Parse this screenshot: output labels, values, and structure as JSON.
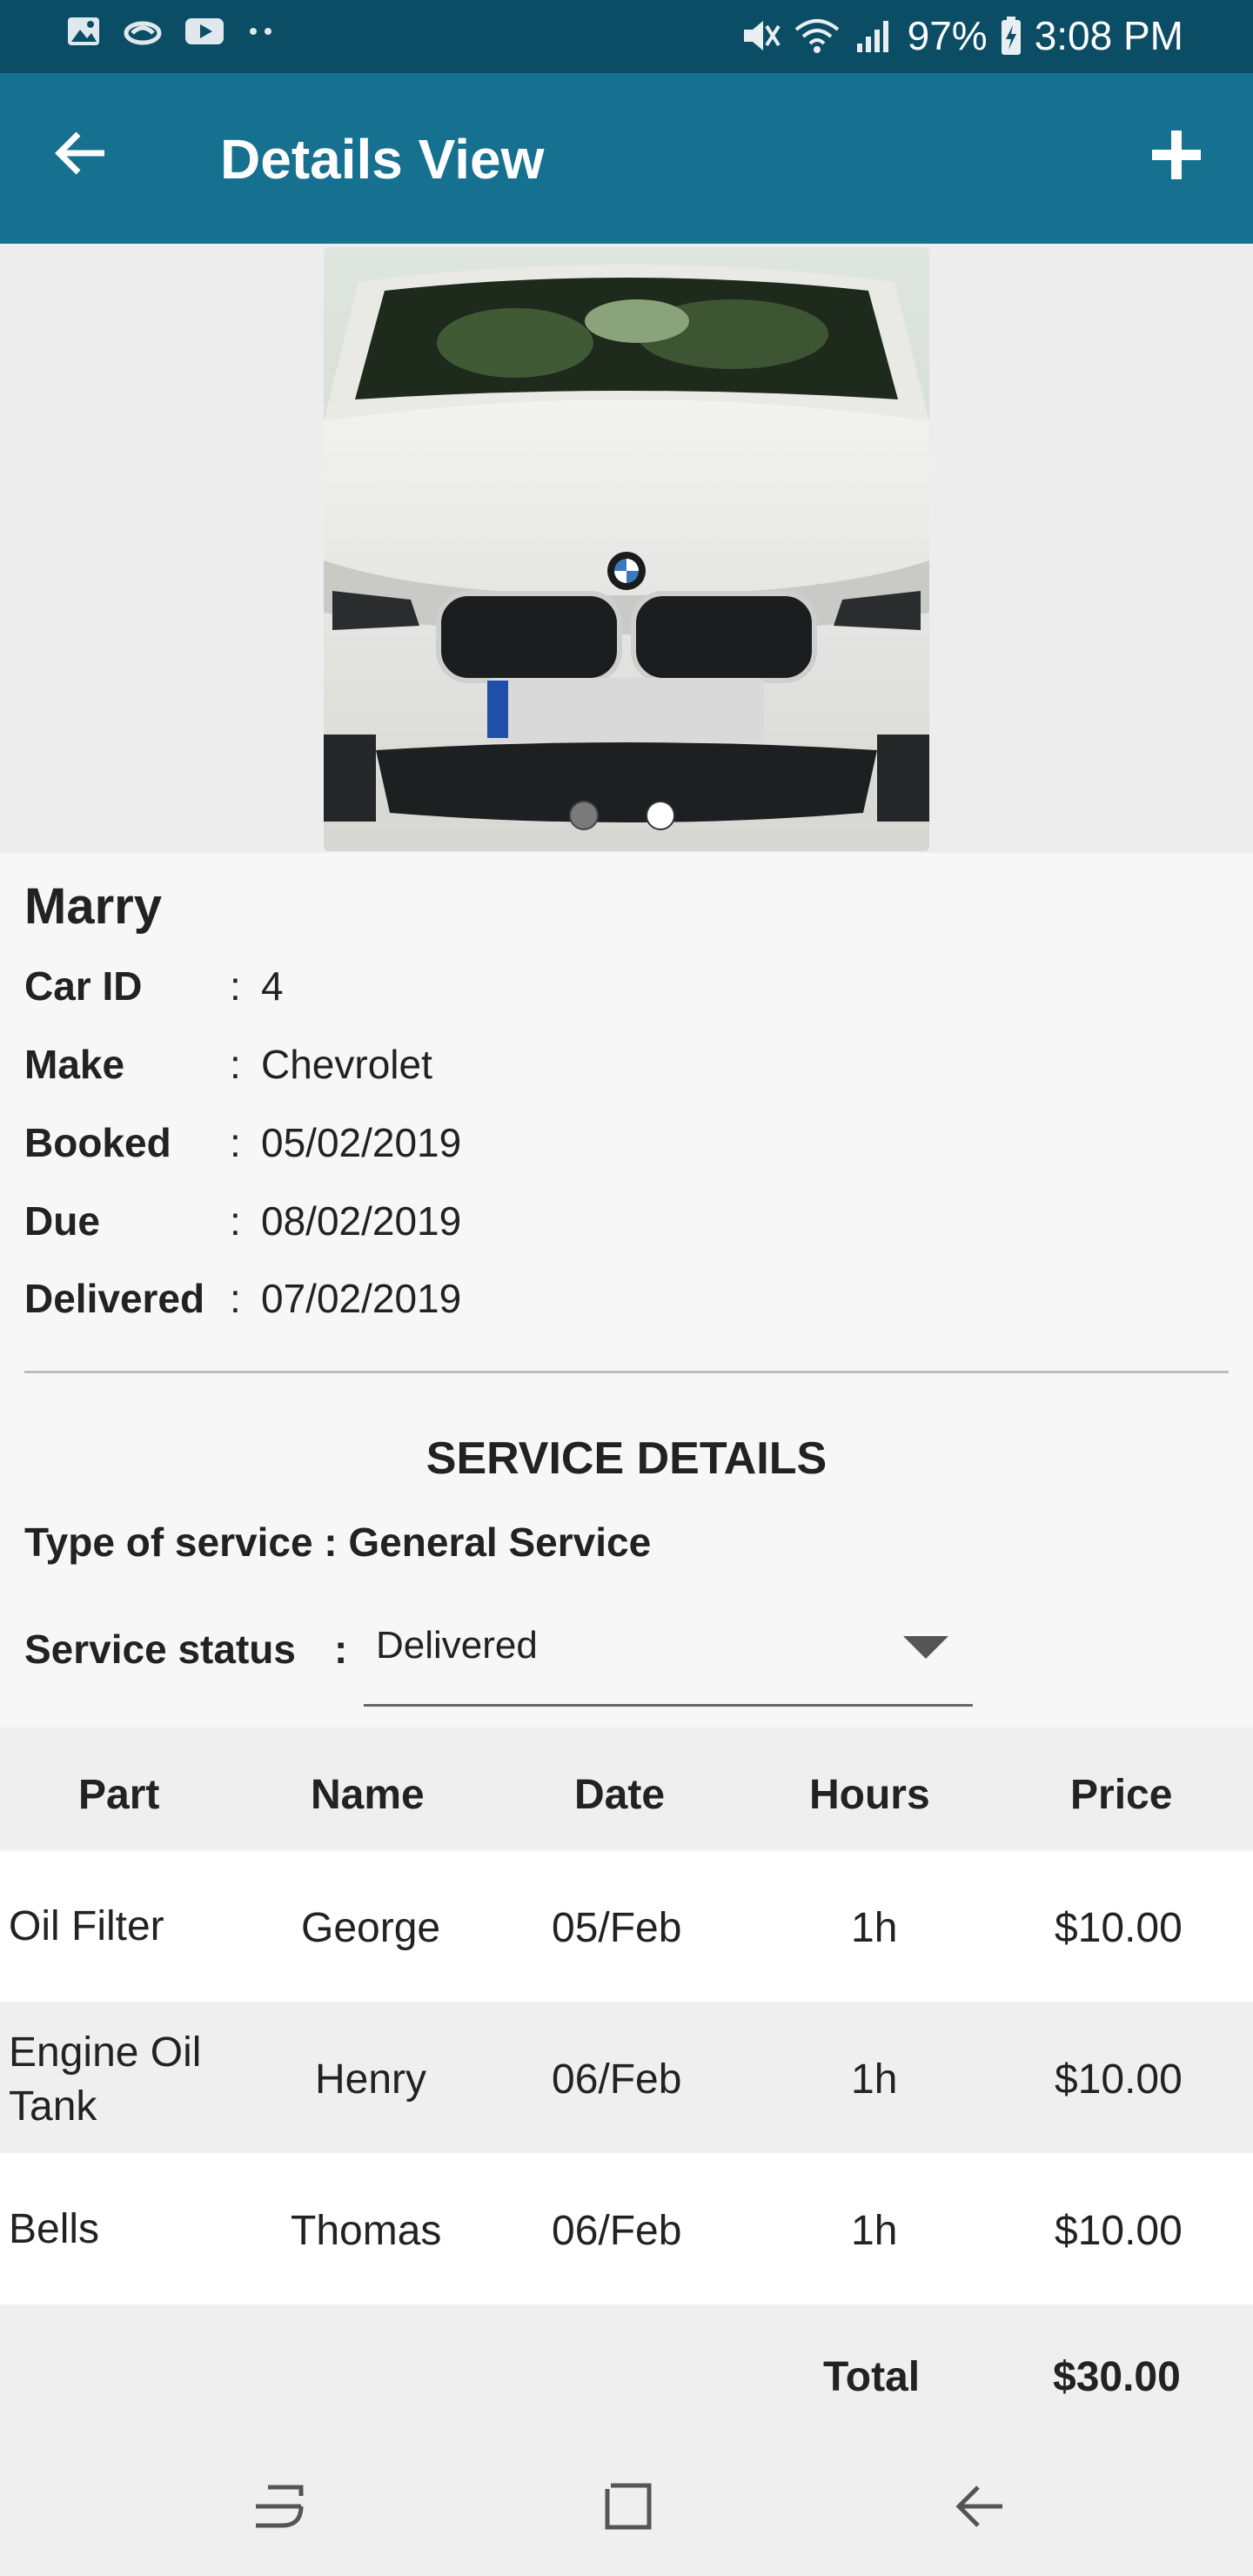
{
  "status_bar": {
    "battery": "97%",
    "time": "3:08 PM",
    "left_icons": [
      "image-icon",
      "cloud-icon",
      "youtube-icon",
      "more-dots-icon"
    ],
    "right_icons": [
      "mute-icon",
      "wifi-icon",
      "signal-icon",
      "battery-charging-icon"
    ]
  },
  "app_bar": {
    "title": "Details View",
    "back_icon": "arrow-left-icon",
    "add_icon": "plus-icon",
    "color": "#16708f"
  },
  "carousel": {
    "image_subject": "white BMW car front",
    "pages": 2,
    "active_page": 2
  },
  "customer": {
    "name": "Marry",
    "fields": [
      {
        "label": "Car ID",
        "value": "4"
      },
      {
        "label": "Make",
        "value": "Chevrolet"
      },
      {
        "label": "Booked",
        "value": "05/02/2019"
      },
      {
        "label": "Due",
        "value": "08/02/2019"
      },
      {
        "label": "Delivered",
        "value": "07/02/2019"
      }
    ]
  },
  "service": {
    "title": "SERVICE DETAILS",
    "type_text": "Type of service : General Service",
    "status_label": "Service status",
    "status_colon": ":",
    "status_value": "Delivered"
  },
  "parts_table": {
    "headers": [
      "Part",
      "Name",
      "Date",
      "Hours",
      "Price"
    ],
    "rows": [
      {
        "part": "Oil Filter",
        "name": "George",
        "date": "05/Feb",
        "hours": "1h",
        "price": "$10.00"
      },
      {
        "part": "Engine Oil Tank",
        "name": "Henry",
        "date": "06/Feb",
        "hours": "1h",
        "price": "$10.00"
      },
      {
        "part": "Bells",
        "name": "Thomas",
        "date": "06/Feb",
        "hours": "1h",
        "price": "$10.00"
      }
    ],
    "total_label": "Total",
    "total_value": "$30.00"
  },
  "nav_bar": {
    "icons": [
      "recents-icon",
      "home-icon",
      "back-icon"
    ]
  }
}
